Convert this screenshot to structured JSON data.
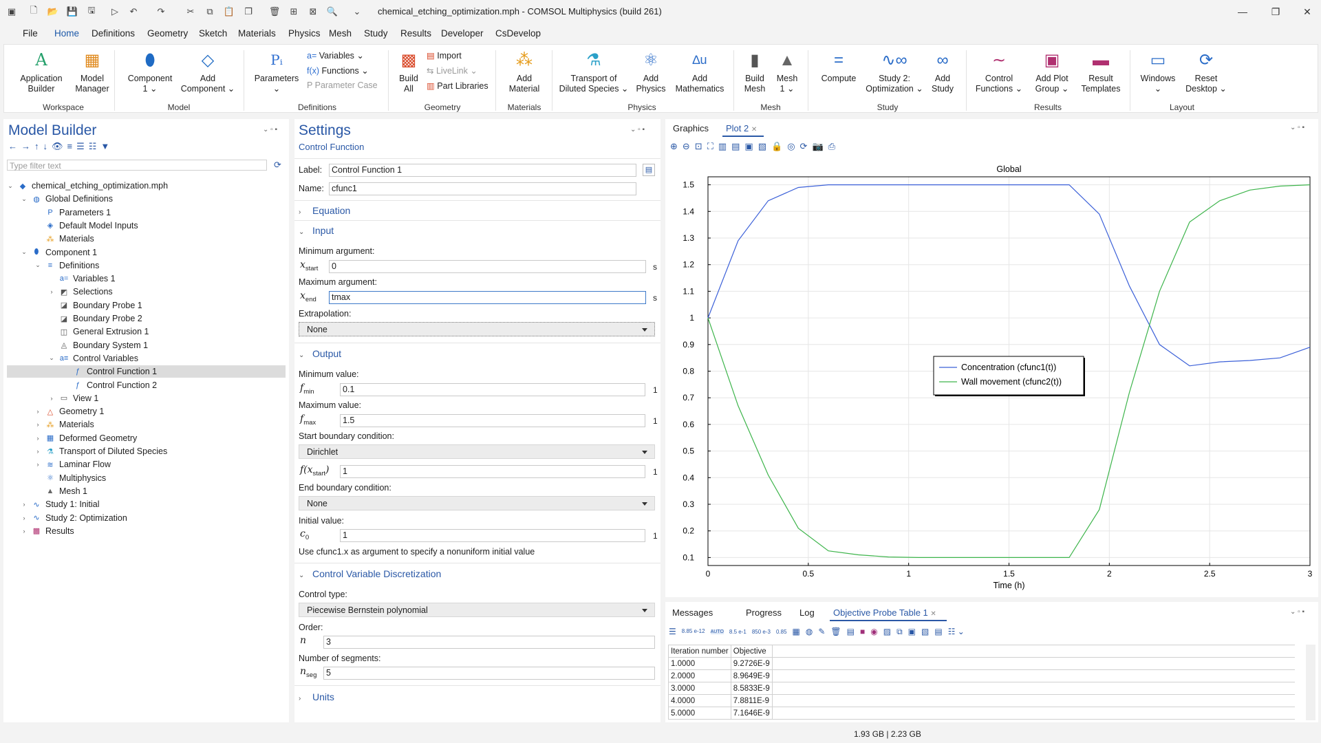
{
  "window": {
    "title": "chemical_etching_optimization.mph - COMSOL Multiphysics (build 261)"
  },
  "menu": {
    "items": [
      "File",
      "Home",
      "Definitions",
      "Geometry",
      "Sketch",
      "Materials",
      "Physics",
      "Mesh",
      "Study",
      "Results",
      "Developer",
      "CsDevelop"
    ],
    "help": "?"
  },
  "ribbon": {
    "workspace": {
      "group": "Workspace",
      "app_builder": [
        "Application",
        "Builder"
      ],
      "model_manager": [
        "Model",
        "Manager"
      ]
    },
    "model": {
      "group": "Model",
      "component": [
        "Component",
        "1"
      ],
      "add_component": [
        "Add",
        "Component"
      ]
    },
    "definitions": {
      "group": "Definitions",
      "parameters": "Parameters",
      "variables": "Variables",
      "functions": "Functions",
      "parameter_case": "Parameter Case"
    },
    "geometry": {
      "group": "Geometry",
      "build_all": [
        "Build",
        "All"
      ],
      "import": "Import",
      "livelink": "LiveLink",
      "part_libraries": "Part Libraries"
    },
    "materials": {
      "group": "Materials",
      "add_material": [
        "Add",
        "Material"
      ]
    },
    "physics": {
      "group": "Physics",
      "transport": [
        "Transport of",
        "Diluted Species"
      ],
      "add_physics": [
        "Add",
        "Physics"
      ],
      "add_math": [
        "Add",
        "Mathematics"
      ]
    },
    "mesh": {
      "group": "Mesh",
      "build_mesh": [
        "Build",
        "Mesh"
      ],
      "mesh1": [
        "Mesh",
        "1"
      ]
    },
    "study": {
      "group": "Study",
      "compute": "Compute",
      "study2": [
        "Study 2:",
        "Optimization"
      ],
      "add_study": [
        "Add",
        "Study"
      ]
    },
    "results": {
      "group": "Results",
      "control_functions": [
        "Control",
        "Functions"
      ],
      "add_plot_group": [
        "Add Plot",
        "Group"
      ],
      "result_templates": [
        "Result",
        "Templates"
      ]
    },
    "layout": {
      "group": "Layout",
      "windows": "Windows",
      "reset_desktop": [
        "Reset",
        "Desktop"
      ]
    }
  },
  "model_builder": {
    "title": "Model Builder",
    "filter_placeholder": "Type filter text",
    "tree": [
      {
        "label": "chemical_etching_optimization.mph",
        "level": 0,
        "tw": "v",
        "icon": "mph-file-icon"
      },
      {
        "label": "Global Definitions",
        "level": 1,
        "tw": "v",
        "icon": "globe-icon"
      },
      {
        "label": "Parameters 1",
        "level": 2,
        "tw": "",
        "icon": "parameters-icon"
      },
      {
        "label": "Default Model Inputs",
        "level": 2,
        "tw": "",
        "icon": "model-inputs-icon"
      },
      {
        "label": "Materials",
        "level": 2,
        "tw": "",
        "icon": "materials-icon"
      },
      {
        "label": "Component 1",
        "level": 1,
        "tw": "v",
        "icon": "component-icon"
      },
      {
        "label": "Definitions",
        "level": 2,
        "tw": "v",
        "icon": "definitions-icon"
      },
      {
        "label": "Variables 1",
        "level": 3,
        "tw": "",
        "icon": "variables-icon"
      },
      {
        "label": "Selections",
        "level": 3,
        "tw": ">",
        "icon": "selections-icon"
      },
      {
        "label": "Boundary Probe 1",
        "level": 3,
        "tw": "",
        "icon": "probe-icon"
      },
      {
        "label": "Boundary Probe 2",
        "level": 3,
        "tw": "",
        "icon": "probe-icon"
      },
      {
        "label": "General Extrusion 1",
        "level": 3,
        "tw": "",
        "icon": "extrusion-icon"
      },
      {
        "label": "Boundary System 1",
        "level": 3,
        "tw": "",
        "icon": "boundary-system-icon"
      },
      {
        "label": "Control Variables",
        "level": 3,
        "tw": "v",
        "icon": "control-variables-icon"
      },
      {
        "label": "Control Function 1",
        "level": 4,
        "tw": "",
        "icon": "control-function-icon",
        "selected": true
      },
      {
        "label": "Control Function 2",
        "level": 4,
        "tw": "",
        "icon": "control-function-icon"
      },
      {
        "label": "View 1",
        "level": 3,
        "tw": ">",
        "icon": "view-icon"
      },
      {
        "label": "Geometry 1",
        "level": 2,
        "tw": ">",
        "icon": "geometry-icon"
      },
      {
        "label": "Materials",
        "level": 2,
        "tw": ">",
        "icon": "materials-icon"
      },
      {
        "label": "Deformed Geometry",
        "level": 2,
        "tw": ">",
        "icon": "deformed-geometry-icon"
      },
      {
        "label": "Transport of Diluted Species",
        "level": 2,
        "tw": ">",
        "icon": "transport-icon"
      },
      {
        "label": "Laminar Flow",
        "level": 2,
        "tw": ">",
        "icon": "laminar-flow-icon"
      },
      {
        "label": "Multiphysics",
        "level": 2,
        "tw": "",
        "icon": "multiphysics-icon"
      },
      {
        "label": "Mesh 1",
        "level": 2,
        "tw": "",
        "icon": "mesh-icon"
      },
      {
        "label": "Study 1: Initial",
        "level": 1,
        "tw": ">",
        "icon": "study-icon"
      },
      {
        "label": "Study 2: Optimization",
        "level": 1,
        "tw": ">",
        "icon": "study-icon"
      },
      {
        "label": "Results",
        "level": 1,
        "tw": ">",
        "icon": "results-icon"
      }
    ]
  },
  "settings": {
    "title": "Settings",
    "subtitle": "Control Function",
    "label_label": "Label:",
    "label_value": "Control Function 1",
    "name_label": "Name:",
    "name_value": "cfunc1",
    "sections": {
      "equation": "Equation",
      "input": "Input",
      "output": "Output",
      "discretization": "Control Variable Discretization",
      "units": "Units"
    },
    "input": {
      "min_arg_label": "Minimum argument:",
      "xstart_sym": "x",
      "xstart_sub": "start",
      "xstart_value": "0",
      "unit_s": "s",
      "max_arg_label": "Maximum argument:",
      "xend_sym": "x",
      "xend_sub": "end",
      "xend_value": "tmax",
      "extrap_label": "Extrapolation:",
      "extrap_value": "None"
    },
    "output": {
      "min_val_label": "Minimum value:",
      "fmin_sym": "f",
      "fmin_sub": "min",
      "fmin_value": "0.1",
      "unit_1": "1",
      "max_val_label": "Maximum value:",
      "fmax_sym": "f",
      "fmax_sub": "max",
      "fmax_value": "1.5",
      "start_bc_label": "Start boundary condition:",
      "start_bc_value": "Dirichlet",
      "fx_sym": "f(x",
      "fx_sub": "start",
      "fx_close": ")",
      "fx_value": "1",
      "end_bc_label": "End boundary condition:",
      "end_bc_value": "None",
      "init_label": "Initial value:",
      "c0_sym": "c",
      "c0_sub": "0",
      "c0_value": "1",
      "hint": "Use cfunc1.x as argument to specify a nonuniform initial value"
    },
    "discretization": {
      "control_type_label": "Control type:",
      "control_type_value": "Piecewise Bernstein polynomial",
      "order_label": "Order:",
      "n_sym": "n",
      "n_value": "3",
      "segments_label": "Number of segments:",
      "nseg_sym": "n",
      "nseg_sub": "seg",
      "nseg_value": "5"
    }
  },
  "graphics": {
    "tabs": [
      "Graphics",
      "Plot 2"
    ],
    "close_glyph": "✕"
  },
  "chart_data": {
    "type": "line",
    "title": "Global",
    "xlabel": "Time (h)",
    "ylabel": "",
    "xlim": [
      0,
      3
    ],
    "ylim": [
      0.07,
      1.53
    ],
    "xticks": [
      "0",
      "0.5",
      "1",
      "1.5",
      "2",
      "2.5",
      "3"
    ],
    "yticks": [
      "0.1",
      "0.2",
      "0.3",
      "0.4",
      "0.5",
      "0.6",
      "0.7",
      "0.8",
      "0.9",
      "1",
      "1.1",
      "1.2",
      "1.3",
      "1.4",
      "1.5"
    ],
    "grid": true,
    "legend_position": "center-right",
    "series": [
      {
        "name": "Concentration (cfunc1(t))",
        "color": "#3a5fd8",
        "x": [
          0,
          0.15,
          0.3,
          0.45,
          0.6,
          0.75,
          0.9,
          1.05,
          1.2,
          1.35,
          1.5,
          1.65,
          1.8,
          1.95,
          2.1,
          2.25,
          2.4,
          2.55,
          2.7,
          2.85,
          3.0
        ],
        "y": [
          1.0,
          1.29,
          1.44,
          1.49,
          1.5,
          1.5,
          1.5,
          1.5,
          1.5,
          1.5,
          1.5,
          1.5,
          1.5,
          1.39,
          1.12,
          0.9,
          0.82,
          0.835,
          0.84,
          0.85,
          0.89
        ]
      },
      {
        "name": "Wall movement (cfunc2(t))",
        "color": "#3cb44a",
        "x": [
          0,
          0.15,
          0.3,
          0.45,
          0.6,
          0.75,
          0.9,
          1.05,
          1.2,
          1.35,
          1.5,
          1.65,
          1.8,
          1.95,
          2.1,
          2.25,
          2.4,
          2.55,
          2.7,
          2.85,
          3.0
        ],
        "y": [
          1.0,
          0.67,
          0.41,
          0.21,
          0.125,
          0.11,
          0.102,
          0.1,
          0.1,
          0.1,
          0.1,
          0.1,
          0.1,
          0.28,
          0.72,
          1.1,
          1.36,
          1.44,
          1.48,
          1.495,
          1.5
        ]
      }
    ]
  },
  "bottom": {
    "tabs": [
      "Messages",
      "Progress",
      "Log",
      "Objective Probe Table 1"
    ],
    "table_headers": [
      "Iteration number",
      "Objective"
    ],
    "table_rows": [
      [
        "1.0000",
        "9.2726E-9"
      ],
      [
        "2.0000",
        "8.9649E-9"
      ],
      [
        "3.0000",
        "8.5833E-9"
      ],
      [
        "4.0000",
        "7.8811E-9"
      ],
      [
        "5.0000",
        "7.1646E-9"
      ]
    ],
    "toolbar_numbers": [
      "8.85 e-12",
      "AUTO",
      "8.5 e-1",
      "850 e-3",
      "0.85"
    ]
  },
  "status": {
    "memory": "1.93 GB | 2.23 GB"
  }
}
